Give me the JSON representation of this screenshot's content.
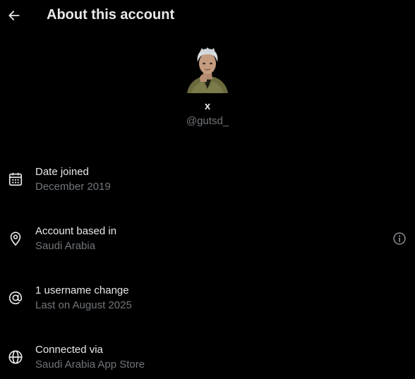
{
  "header": {
    "title": "About this account",
    "back_icon": "arrow-left-icon"
  },
  "profile": {
    "display_name": "x",
    "handle": "@gutsd_"
  },
  "details": [
    {
      "icon": "calendar-icon",
      "title": "Date joined",
      "value": "December 2019"
    },
    {
      "icon": "location-pin-icon",
      "title": "Account based in",
      "value": "Saudi Arabia",
      "info_icon": "info-circle-icon"
    },
    {
      "icon": "at-sign-icon",
      "title": "1 username change",
      "value": "Last on August 2025"
    },
    {
      "icon": "globe-icon",
      "title": "Connected via",
      "value": "Saudi Arabia App Store"
    }
  ],
  "colors": {
    "background": "#000000",
    "primary_text": "#e7e9ea",
    "secondary_text": "#71767b"
  }
}
